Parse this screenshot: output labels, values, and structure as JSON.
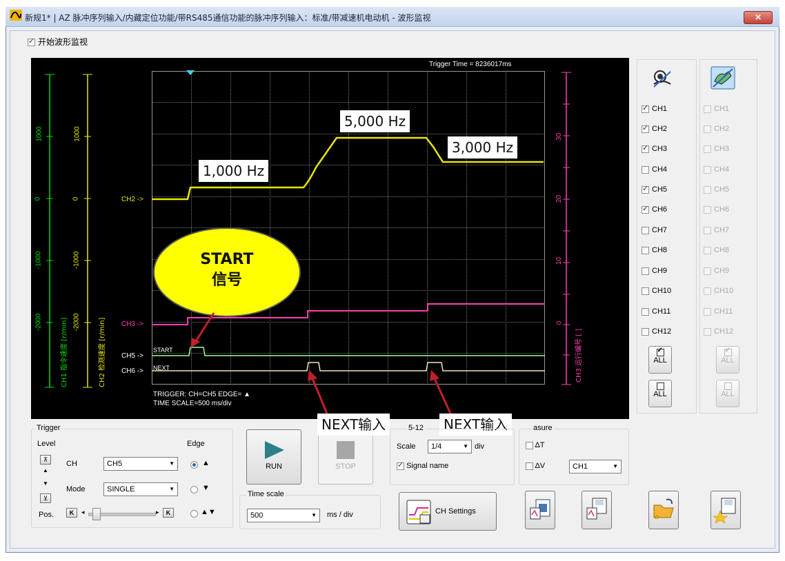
{
  "window": {
    "title": "新规1* | AZ 脉冲序列输入/内藏定位功能/带RS485通信功能的脉冲序列输入：标准/带减速机电动机 - 波形监视",
    "close_label": "✕"
  },
  "monitor": {
    "start_label": "开始波形监视",
    "start_checked": true
  },
  "scope": {
    "trigger_time": "Trigger Time = 8236017ms",
    "trigger_info": "TRIGGER: CH=CH5 EDGE= ▲",
    "time_scale_info": "TIME SCALE=500 ms/div",
    "axes": {
      "ch1_label": "CH1 指令速度 [r/min]",
      "ch2_label": "CH2 检测速度 [r/min]",
      "ch3_label": "CH3 运行编号 [ ]",
      "ch1_ticks": [
        "1000",
        "0",
        "-1000",
        "-2000"
      ],
      "ch2_ticks": [
        "1000",
        "0",
        "-1000",
        "-2000"
      ],
      "ch3_ticks": [
        "30",
        "20",
        "10",
        "0"
      ]
    },
    "channel_markers": {
      "ch2": "CH2 ->",
      "ch3": "CH3 ->",
      "ch5": "CH5 ->",
      "ch6": "CH6 ->"
    },
    "signal_names": {
      "start": "START",
      "next": "NEXT"
    },
    "colors": {
      "ch1": "#00e000",
      "ch2": "#e8e800",
      "ch3": "#ff3fb0",
      "ch5": "#9aff9a",
      "ch6": "#f1e6b5",
      "background": "#000000",
      "grid": "#7a7a7a"
    }
  },
  "annotations": {
    "freq_1": "1,000 Hz",
    "freq_2": "5,000 Hz",
    "freq_3": "3,000 Hz",
    "start_bubble": [
      "START",
      "信号"
    ],
    "next_input_1": "NEXT输入",
    "next_input_2": "NEXT输入"
  },
  "channels_visible": [
    {
      "label": "CH1",
      "checked": true
    },
    {
      "label": "CH2",
      "checked": true
    },
    {
      "label": "CH3",
      "checked": true
    },
    {
      "label": "CH4",
      "checked": false
    },
    {
      "label": "CH5",
      "checked": true
    },
    {
      "label": "CH6",
      "checked": true
    },
    {
      "label": "CH7",
      "checked": false
    },
    {
      "label": "CH8",
      "checked": false
    },
    {
      "label": "CH9",
      "checked": false
    },
    {
      "label": "CH10",
      "checked": false
    },
    {
      "label": "CH11",
      "checked": false
    },
    {
      "label": "CH12",
      "checked": false
    }
  ],
  "channels_secondary": [
    "CH1",
    "CH2",
    "CH3",
    "CH4",
    "CH5",
    "CH6",
    "CH7",
    "CH8",
    "CH9",
    "CH10",
    "CH11",
    "CH12"
  ],
  "all_label": "ALL",
  "trigger": {
    "group_label": "Trigger",
    "level_label": "Level",
    "edge_label": "Edge",
    "ch_label": "CH",
    "ch_value": "CH5",
    "mode_label": "Mode",
    "mode_value": "SINGLE",
    "pos_label": "Pos.",
    "edge_rising": "▲",
    "edge_falling": "▼",
    "edge_both": "▲▼"
  },
  "run": {
    "run_label": "RUN",
    "stop_label": "STOP"
  },
  "time_scale": {
    "label": "Time scale",
    "value": "500",
    "unit": "ms / div"
  },
  "ch5_12": {
    "group_label": "5-12",
    "scale_label": "Scale",
    "scale_value": "1/4",
    "scale_unit": "div",
    "signal_name_label": "Signal name",
    "signal_name_checked": true
  },
  "measure": {
    "group_label": "asure",
    "dt_label": "ΔT",
    "dv_label": "ΔV",
    "ch_value": "CH1"
  },
  "ch_settings_label": "CH Settings"
}
